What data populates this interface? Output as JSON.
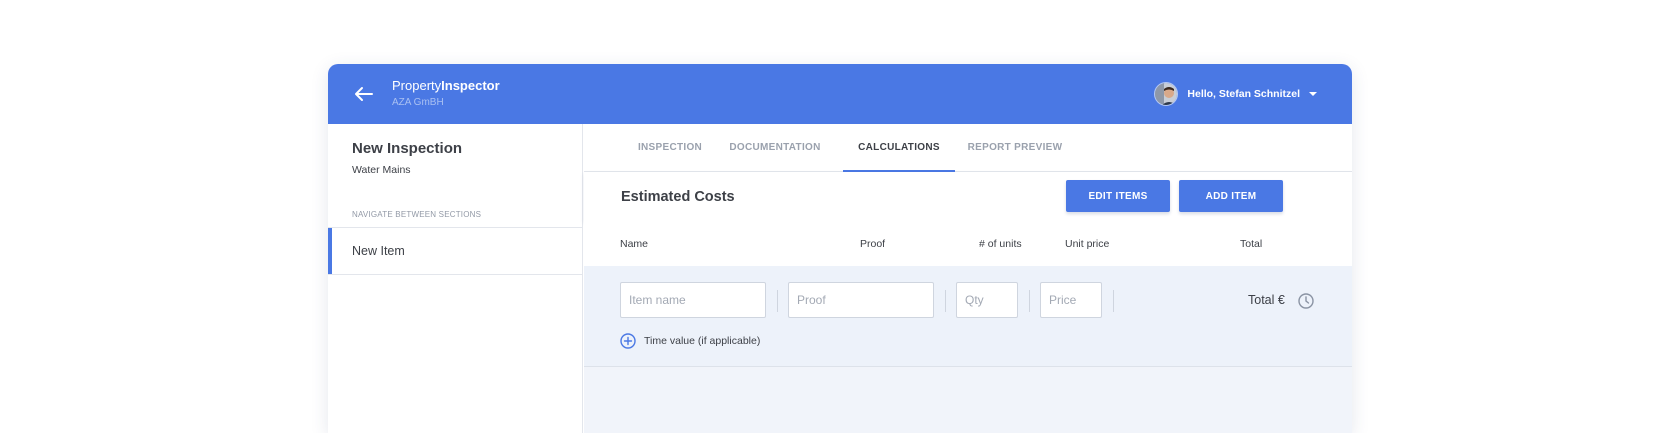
{
  "header": {
    "brand_regular": "Property",
    "brand_bold": "Inspector",
    "company": "AZA GmBH",
    "user_greeting": "Hello, Stefan Schnitzel",
    "back_icon": "arrow-left-icon",
    "caret_icon": "caret-down-icon",
    "accent_color": "#4a78e4"
  },
  "sidebar": {
    "title": "New Inspection",
    "subtitle": "Water Mains",
    "nav_caption": "NAVIGATE BETWEEN SECTIONS",
    "items": [
      {
        "label": "New Item",
        "active": true
      }
    ]
  },
  "tabs": [
    {
      "label": "INSPECTION",
      "active": false
    },
    {
      "label": "DOCUMENTATION",
      "active": false
    },
    {
      "label": "CALCULATIONS",
      "active": true
    },
    {
      "label": "REPORT PREVIEW",
      "active": false
    }
  ],
  "costs": {
    "title": "Estimated Costs",
    "edit_button": "EDIT ITEMS",
    "add_button": "ADD ITEM"
  },
  "table": {
    "columns": [
      "Name",
      "Proof",
      "# of units",
      "Unit price",
      "Total"
    ],
    "row": {
      "name_placeholder": "Item name",
      "name_value": "",
      "proof_placeholder": "Proof",
      "proof_value": "",
      "qty_placeholder": "Qty",
      "qty_value": "",
      "price_placeholder": "Price",
      "price_value": "",
      "total_label": "Total €",
      "time_toggle_label": "Time value (if applicable)",
      "time_toggle_icon": "plus-circle-icon",
      "clock_icon": "clock-icon"
    }
  }
}
